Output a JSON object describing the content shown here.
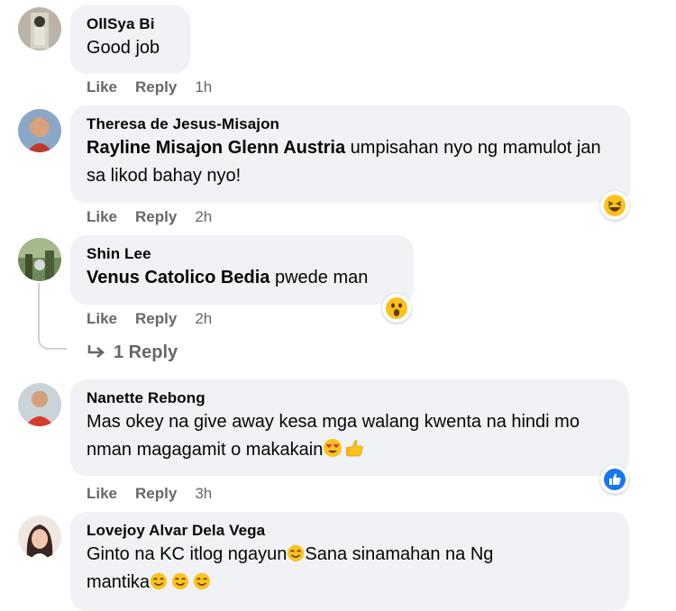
{
  "comments": [
    {
      "author": "OllSya Bi",
      "text": "Good job",
      "like": "Like",
      "reply": "Reply",
      "time": "1h"
    },
    {
      "author": "Theresa de Jesus-Misajon",
      "mention": "Rayline Misajon Glenn Austria",
      "text": " umpisahan nyo ng mamulot jan sa likod bahay nyo!",
      "like": "Like",
      "reply": "Reply",
      "time": "2h",
      "reaction": "laughing-emoji"
    },
    {
      "author": "Shin Lee",
      "mention": "Venus Catolico Bedia",
      "text": " pwede man",
      "like": "Like",
      "reply": "Reply",
      "time": "2h",
      "reaction": "wow-emoji",
      "replies_label": "1 Reply"
    },
    {
      "author": "Nanette Rebong",
      "text": "Mas okey na give away kesa mga walang kwenta na hindi mo nman magagamit o makakain",
      "like": "Like",
      "reply": "Reply",
      "time": "3h",
      "reaction": "like-reaction"
    },
    {
      "author": "Lovejoy Alvar Dela Vega",
      "text_line1": "Ginto na KC itlog ngayun",
      "text_line1b": "Sana sinamahan na Ng",
      "text_line2": "mantika"
    }
  ],
  "colors": {
    "bubble": "#f0f2f5",
    "meta": "#65676b",
    "like_blue": "#1877f2"
  }
}
